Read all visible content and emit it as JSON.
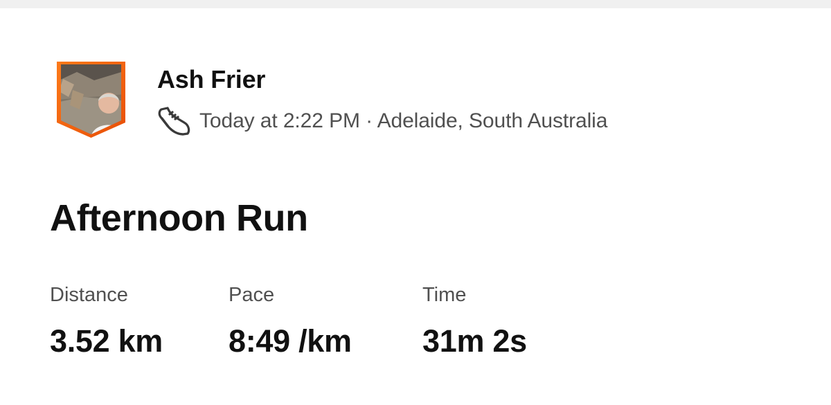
{
  "activity": {
    "athlete_name": "Ash Frier",
    "activity_icon": "running-shoe-icon",
    "timestamp_location": "Today at 2:22 PM · Adelaide, South Australia",
    "title": "Afternoon Run"
  },
  "stats": {
    "distance": {
      "label": "Distance",
      "value": "3.52 km"
    },
    "pace": {
      "label": "Pace",
      "value": "8:49 /km"
    },
    "time": {
      "label": "Time",
      "value": "31m 2s"
    }
  },
  "colors": {
    "avatar_border": "#fc4c02",
    "primary_text": "#111111",
    "secondary_text": "#505050"
  }
}
